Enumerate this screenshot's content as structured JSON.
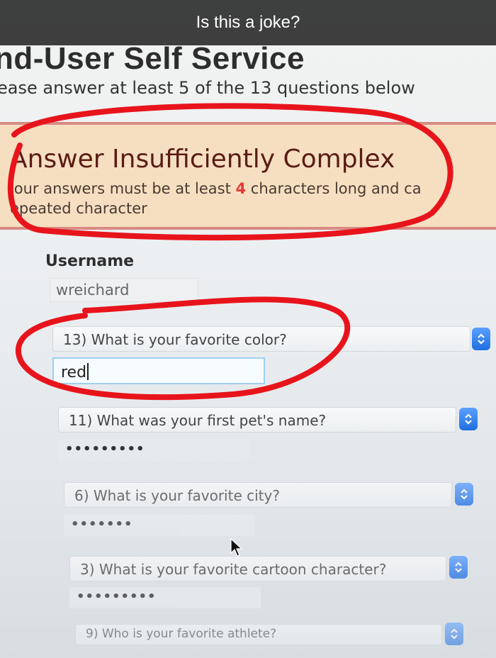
{
  "caption": "Is this a joke?",
  "page": {
    "title": "nd-User Self Service",
    "subtitle": "ease answer at least 5 of the 13 questions below"
  },
  "error": {
    "title": "Answer Insufficiently Complex",
    "line1_a": "'our answers must be at least ",
    "line1_num": "4",
    "line1_b": " characters long and ca",
    "line2": "epeated character"
  },
  "username": {
    "label": "Username",
    "value": "wreichard"
  },
  "questions": [
    {
      "select": "13) What is your favorite color?",
      "answer": "red"
    },
    {
      "select": "11) What was your first pet's name?",
      "answer": "•••••••••"
    },
    {
      "select": "6) What is your favorite city?",
      "answer": "•••••••"
    },
    {
      "select": "3) What is your favorite cartoon character?",
      "answer": "•••••••••"
    },
    {
      "select": "9) Who is your favorite athlete?",
      "answer": ""
    }
  ],
  "colors": {
    "annotation": "#e8141c",
    "error_bg": "#f6dfc1",
    "accent": "#2a7cf0"
  },
  "icons": {
    "select_arrow": "chevron-up-down-icon",
    "mouse": "mouse-pointer-icon"
  }
}
